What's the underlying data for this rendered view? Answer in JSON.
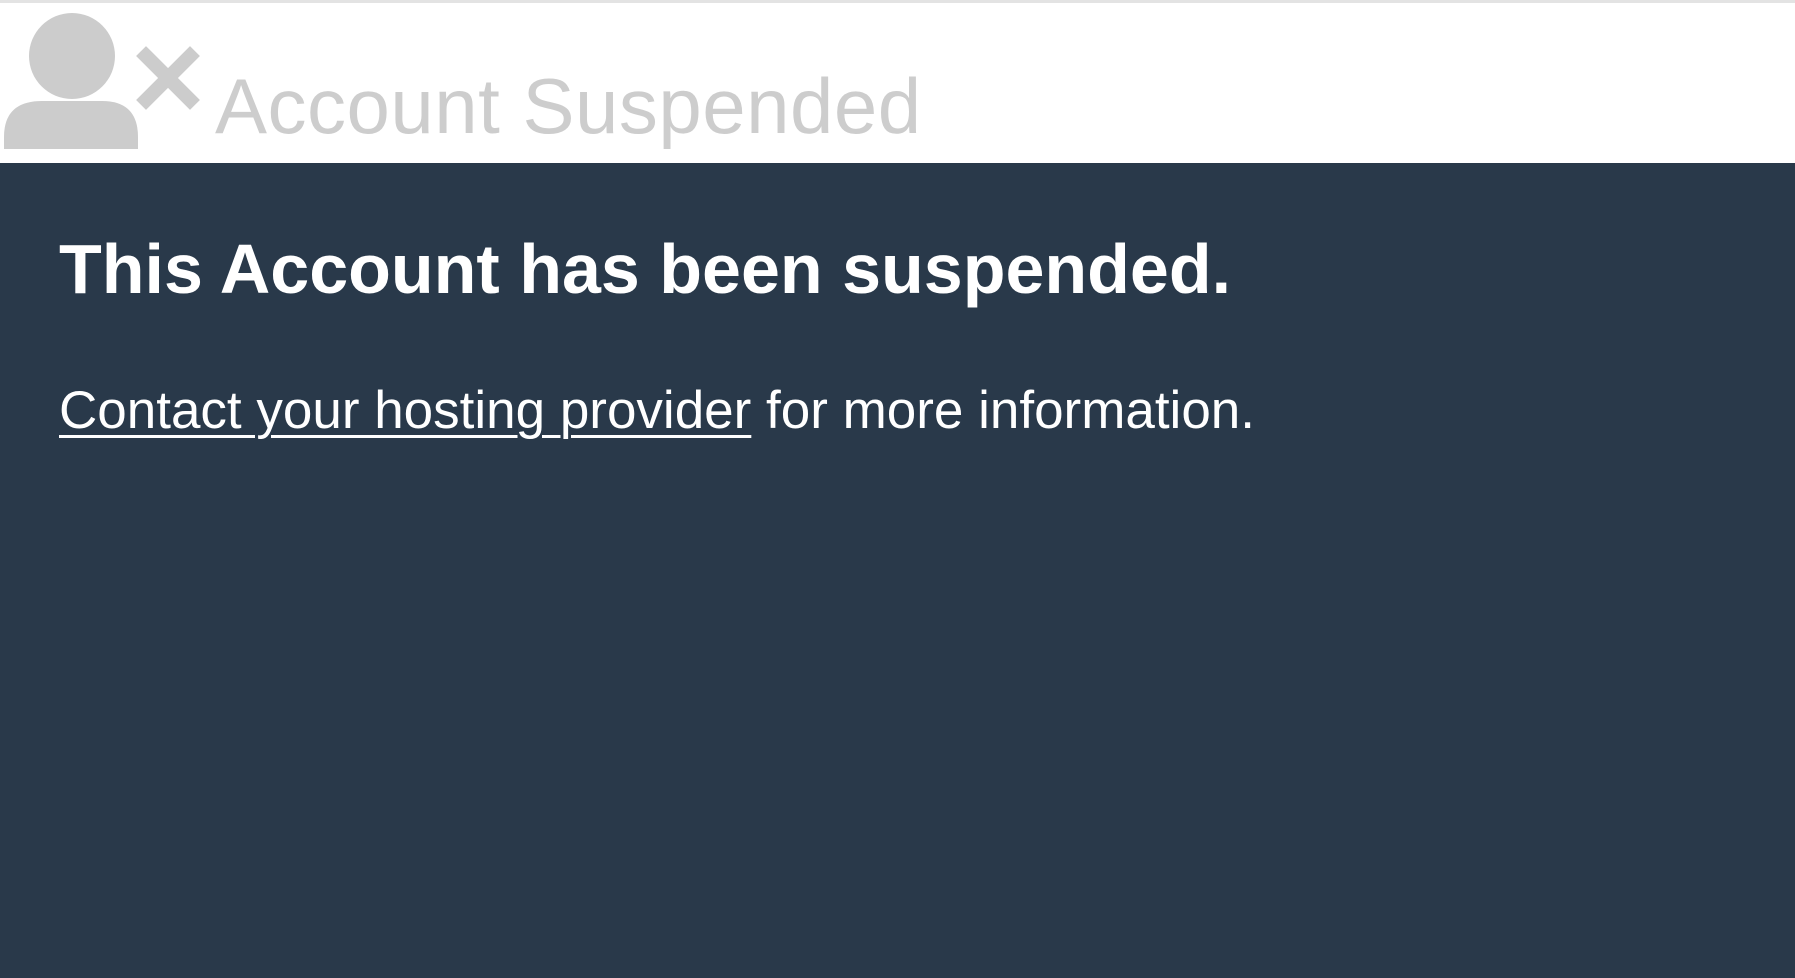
{
  "header": {
    "title": "Account Suspended",
    "icon": "user-suspended-icon"
  },
  "main": {
    "heading": "This Account has been suspended.",
    "contact_link_text": "Contact your hosting provider",
    "message_suffix": " for more information."
  },
  "colors": {
    "header_background": "#ffffff",
    "header_text": "#cdcdcd",
    "icon": "#cccccc",
    "main_background": "#29394a",
    "main_text": "#ffffff"
  }
}
